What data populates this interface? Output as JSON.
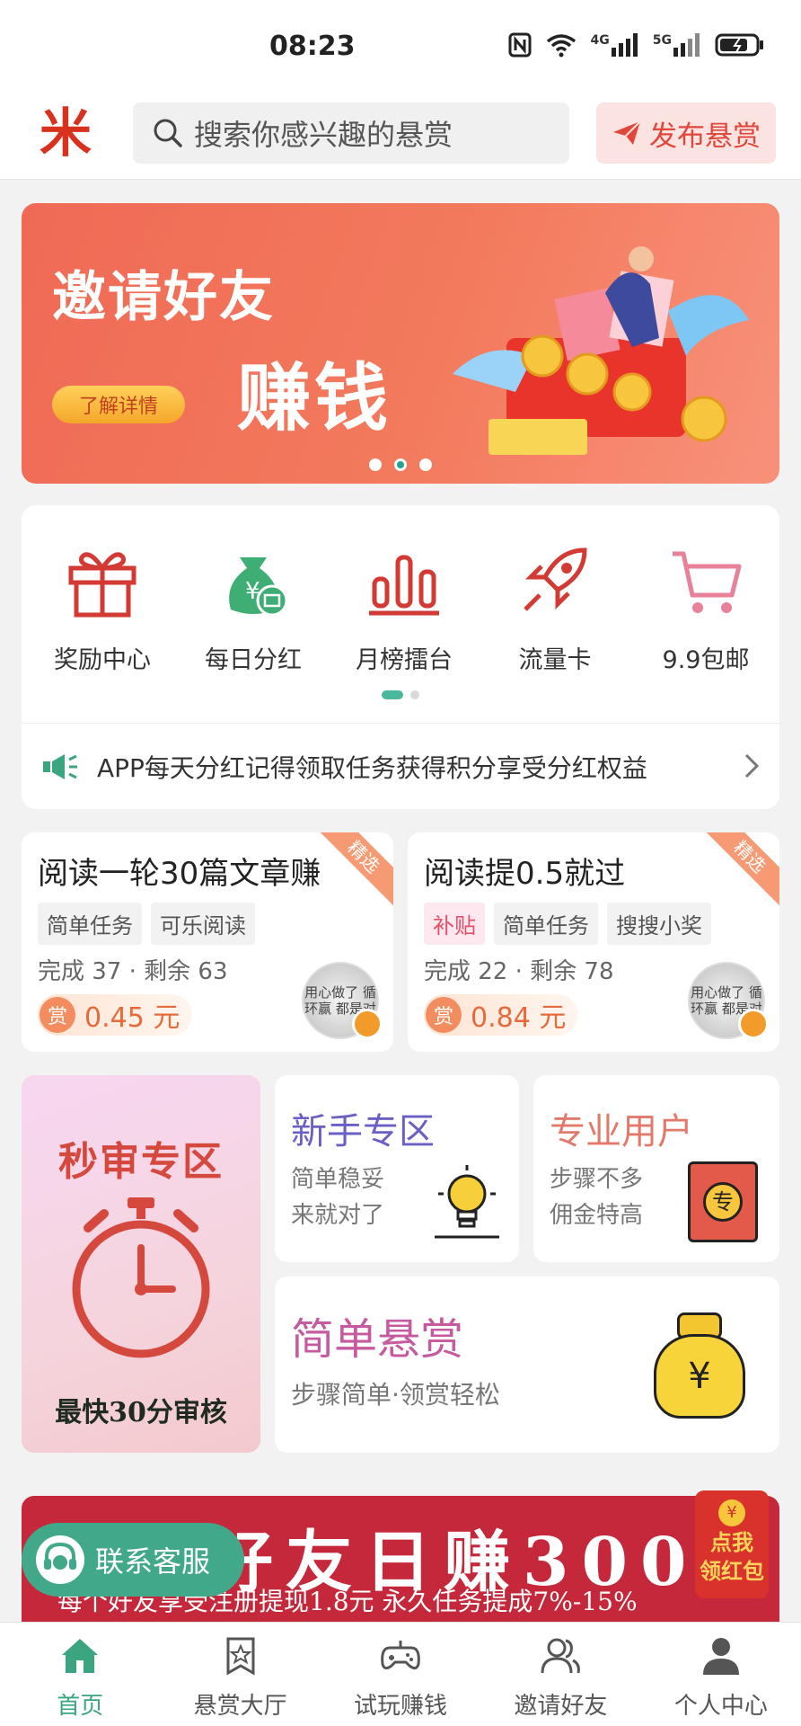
{
  "status_bar": {
    "time": "08:23",
    "network1": "4G",
    "network2": "5G"
  },
  "header": {
    "logo_char": "米",
    "search_placeholder": "搜索你感兴趣的悬赏",
    "publish_label": "发布悬赏"
  },
  "banner": {
    "title": "邀请好友",
    "subtitle": "赚钱",
    "button_label": "了解详情",
    "slide_count": 3,
    "active_slide": 2
  },
  "menu": {
    "items": [
      {
        "label": "奖励中心",
        "icon": "gift-icon"
      },
      {
        "label": "每日分红",
        "icon": "money-bag-icon"
      },
      {
        "label": "月榜擂台",
        "icon": "bar-chart-icon"
      },
      {
        "label": "流量卡",
        "icon": "rocket-icon"
      },
      {
        "label": "9.9包邮",
        "icon": "cart-icon"
      }
    ],
    "notice": "APP每天分红记得领取任务获得积分享受分红权益"
  },
  "tasks": [
    {
      "title": "阅读一轮30篇文章赚",
      "tags": [
        "简单任务",
        "可乐阅读"
      ],
      "stats": "完成 37 · 剩余 63",
      "reward_badge": "赏",
      "reward": "0.45 元",
      "ribbon": "精选",
      "avatar_text": "用心做了 循环赢 都是对"
    },
    {
      "title": "阅读提0.5就过",
      "tags": [
        "补贴",
        "简单任务",
        "搜搜小奖"
      ],
      "stats": "完成 22 · 剩余 78",
      "reward_badge": "赏",
      "reward": "0.84 元",
      "ribbon": "精选",
      "avatar_text": "用心做了 循环赢 都是对"
    }
  ],
  "zones": {
    "fast_review": {
      "title": "秒审专区",
      "subtitle": "最快30分审核"
    },
    "newbie": {
      "title": "新手专区",
      "line1": "简单稳妥",
      "line2": "来就对了"
    },
    "pro": {
      "title": "专业用户",
      "line1": "步骤不多",
      "line2": "佣金特高",
      "book_char": "专"
    },
    "simple": {
      "title": "简单悬赏",
      "subtitle": "步骤简单·领赏轻松",
      "bag_char": "¥"
    }
  },
  "promo": {
    "headline": "邀请好友日赚300以上",
    "subline": "每个好友享受注册提现1.8元    永久任务提成7%-15%"
  },
  "redpack": {
    "coin": "¥",
    "line1": "点我",
    "line2": "领红包"
  },
  "service_label": "联系客服",
  "tabbar": [
    {
      "label": "首页",
      "icon": "home-icon",
      "active": true
    },
    {
      "label": "悬赏大厅",
      "icon": "star-bookmark-icon",
      "active": false
    },
    {
      "label": "试玩赚钱",
      "icon": "gamepad-icon",
      "active": false
    },
    {
      "label": "邀请好友",
      "icon": "users-icon",
      "active": false
    },
    {
      "label": "个人中心",
      "icon": "person-icon",
      "active": false
    }
  ],
  "colors": {
    "accent": "#3aa57f",
    "brand_red": "#e0463a",
    "reward_orange": "#e66a3a"
  }
}
